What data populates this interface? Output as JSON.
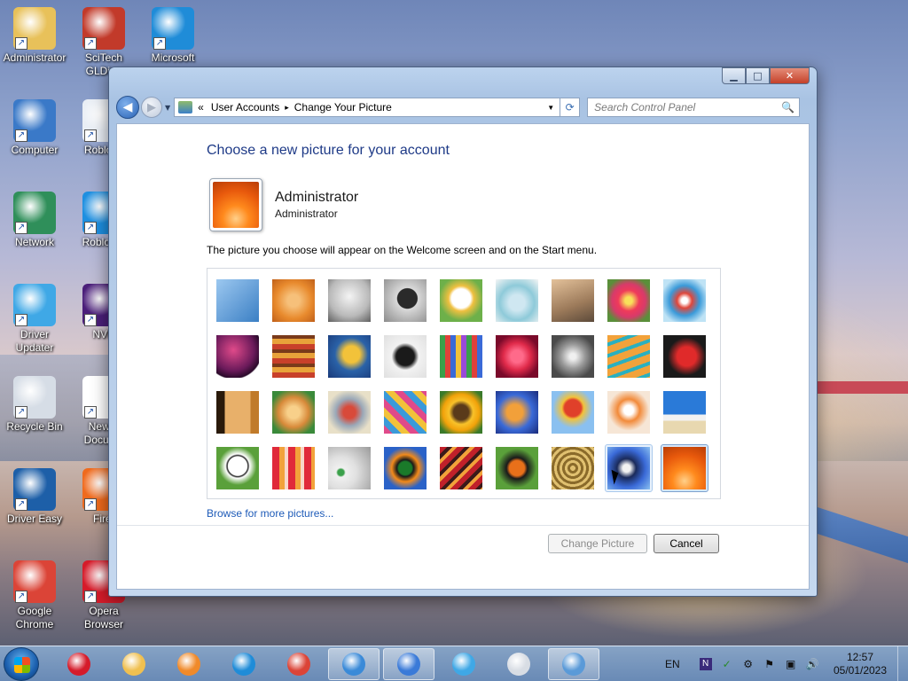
{
  "desktop": {
    "icons": [
      {
        "label": "Administrator",
        "icon": "user-folder-icon",
        "color": "#e8c15a"
      },
      {
        "label": "SciTech GLDir...",
        "icon": "scitech-app-icon",
        "color": "#c23a2a"
      },
      {
        "label": "Microsoft",
        "icon": "edge-icon",
        "color": "#1f8cd8"
      },
      {
        "label": "Computer",
        "icon": "computer-icon",
        "color": "#3a79c8"
      },
      {
        "label": "Roblox I",
        "icon": "roblox-icon",
        "color": "#e9eef5"
      },
      {
        "label": "Network",
        "icon": "network-icon",
        "color": "#2f8f5a"
      },
      {
        "label": "Roblox S",
        "icon": "roblox-studio-icon",
        "color": "#1e8fe0"
      },
      {
        "label": "Driver Updater",
        "icon": "driver-updater-icon",
        "color": "#3fa8e6"
      },
      {
        "label": "NVD",
        "icon": "nvda-icon",
        "color": "#4b1f7a"
      },
      {
        "label": "Recycle Bin",
        "icon": "recycle-bin-icon",
        "color": "#d6dde6"
      },
      {
        "label": "New T Docume",
        "icon": "text-document-icon",
        "color": "#ffffff"
      },
      {
        "label": "Driver Easy",
        "icon": "driver-easy-icon",
        "color": "#1d5fa8"
      },
      {
        "label": "Firef",
        "icon": "firefox-icon",
        "color": "#ef6a1d"
      },
      {
        "label": "Google Chrome",
        "icon": "chrome-icon",
        "color": "#db4437"
      },
      {
        "label": "Opera Browser",
        "icon": "opera-icon",
        "color": "#d51b2a"
      }
    ]
  },
  "window": {
    "controls": {
      "minimize": "▁",
      "maximize": "□",
      "close": "✕"
    },
    "nav": {
      "back": "◀",
      "forward": "▶",
      "history": "▼"
    },
    "address": {
      "prefix": "«",
      "crumbs": [
        "User Accounts",
        "Change Your Picture"
      ],
      "separator": "▸",
      "dropdown": "▼"
    },
    "refresh": "⟳",
    "search": {
      "placeholder": "Search Control Panel",
      "icon": "🔍"
    },
    "heading": "Choose a new picture for your account",
    "user": {
      "name": "Administrator",
      "type": "Administrator"
    },
    "info": "The picture you choose will appear on the Welcome screen and on the Start menu.",
    "pictures": [
      {
        "name": "roller-coaster",
        "bg": "linear-gradient(135deg,#9cc8f0,#3b7fc4)"
      },
      {
        "name": "starfish",
        "bg": "radial-gradient(circle,#f6c07a 20%,#e88a2d 60%,#c0601a)"
      },
      {
        "name": "robot-figure",
        "bg": "radial-gradient(circle at 50% 40%,#f4f4f4,#b9b9b9 60%,#5f5f5f)"
      },
      {
        "name": "record-player",
        "bg": "radial-gradient(circle at 55% 45%,#2a2a2a 30%,#d9d9d9 32%,#8b8b8b)"
      },
      {
        "name": "lucky-cat",
        "bg": "radial-gradient(circle at 50% 45%,#fff 30%,#f0c040 40%,#6db04a 70%)"
      },
      {
        "name": "spinning-top",
        "bg": "radial-gradient(circle at 50% 55%,#cfe7f1 25%,#8ecad9 55%,#f5f5f5)"
      },
      {
        "name": "cat",
        "bg": "linear-gradient(160deg,#e3c19a,#9c7a5a 60%,#5c4a3a)"
      },
      {
        "name": "flower",
        "bg": "radial-gradient(circle,#f8e05a 12%,#ef3a5a 35%,#d83a6a 55%,#5a8f3a 80%)"
      },
      {
        "name": "ferris-wheel",
        "bg": "radial-gradient(circle,#ffffff 10%,#e0463a 25%,#3a9ad9 50%,#bfe3f5 80%)"
      },
      {
        "name": "ball",
        "bg": "radial-gradient(circle at 40% 35%,#e04a8a,#6a1a5a 55%,#2a0a2a 75%,#ffffff 78%)"
      },
      {
        "name": "fabric",
        "bg": "repeating-linear-gradient(0deg,#c8402a 0 6px,#e8a23a 6px 12px,#7a3a1a 12px 16px)"
      },
      {
        "name": "leaf",
        "bg": "radial-gradient(circle at 55% 45%,#f2c23a 25%,#2a62a8 50%,#1a3a7a)"
      },
      {
        "name": "dog",
        "bg": "radial-gradient(circle at 50% 50%,#1a1a1a 30%,#f2f2f2 45%,#e0e0e0)"
      },
      {
        "name": "crayons",
        "bg": "repeating-linear-gradient(90deg,#3aa04a 0 6px,#e0403a 6px 12px,#3a6ad8 12px 18px,#f2c23a 18px 24px,#9a4ad8 24px 30px)"
      },
      {
        "name": "star-lantern",
        "bg": "radial-gradient(circle,#ff6a8a 20%,#e02a4a 45%,#7a0a2a 75%)"
      },
      {
        "name": "jacks",
        "bg": "radial-gradient(circle,#f0f0f0 10%,#9a9a9a 40%,#4a4a4a 75%)"
      },
      {
        "name": "stairs",
        "bg": "repeating-linear-gradient(160deg,#f2a23a 0 8px,#2ab0c0 8px 12px)"
      },
      {
        "name": "origami-crane",
        "bg": "radial-gradient(circle at 55% 50%,#e02a2a 30%,#1a1a1a 60%)"
      },
      {
        "name": "guitar",
        "bg": "linear-gradient(90deg,#2a1a0a 0 20%,#e8b06a 20% 80%,#c07a2a 80%)"
      },
      {
        "name": "pomeranian",
        "bg": "radial-gradient(circle,#f8d08a 20%,#d88a3a 50%,#3a8a3a 80%)"
      },
      {
        "name": "toy-robot",
        "bg": "radial-gradient(circle,#d84a3a 20%,#9aa8b8 45%,#e8e0c8 75%)"
      },
      {
        "name": "scarves",
        "bg": "repeating-linear-gradient(45deg,#e04a8a 0 7px,#3a9ad9 7px 14px,#f2c23a 14px 21px)"
      },
      {
        "name": "sunflower",
        "bg": "radial-gradient(circle,#5a3a1a 25%,#f8c22a 40%,#f2a20a 60%,#3a7a2a 85%)"
      },
      {
        "name": "fish",
        "bg": "radial-gradient(circle at 45% 50%,#f2a03a 25%,#3a6ad8 55%,#1a2a7a)"
      },
      {
        "name": "hot-air-balloon",
        "bg": "radial-gradient(circle at 50% 40%,#e0402a 25%,#f2c23a 33%,#8ac0f0 60%)"
      },
      {
        "name": "doll",
        "bg": "radial-gradient(circle at 50% 45%,#ffffff 15%,#f28a3a 35%,#f6e6d6 65%)"
      },
      {
        "name": "beach",
        "bg": "linear-gradient(180deg,#2a7ad8 0 55%,#f2f2f2 55% 70%,#e8d8b0 70%)"
      },
      {
        "name": "soccer-ball",
        "bg": "radial-gradient(circle at 50% 45%,#ffffff 30%,#1a1a1a 33%,#ffffff 38%,#5aa03a 60%)"
      },
      {
        "name": "silk",
        "bg": "repeating-linear-gradient(90deg,#e02a3a 0 8px,#f2a23a 8px 14px,#f8d8c8 14px 18px)"
      },
      {
        "name": "marbles",
        "bg": "radial-gradient(circle at 30% 60%,#3aa04a 8%,#f0f0f0 12%,#e0e0e0 40%,#9a9a9a)"
      },
      {
        "name": "window-frame",
        "bg": "radial-gradient(circle,#1a7a2a 22%,#1a1a1a 28%,#f28a1a 45%,#2a62c8 70%)"
      },
      {
        "name": "rug",
        "bg": "repeating-linear-gradient(135deg,#c0202a 0 6px,#3a1a1a 6px 10px,#f2a23a 10px 14px)"
      },
      {
        "name": "butterfly",
        "bg": "radial-gradient(circle,#e8701a 25%,#1a1a1a 35%,#5aa03a 65%)"
      },
      {
        "name": "basket",
        "bg": "repeating-radial-gradient(circle,#e0c070 0 3px,#8a6a2a 3px 6px)"
      },
      {
        "name": "lighthouse",
        "bg": "radial-gradient(circle at 45% 50%,#f2f2f2 12%,#1a2a5a 30%,#3a6ad8 60%,#8ac0f0)"
      },
      {
        "name": "orange-flower",
        "bg": "radial-gradient(circle at 50% 80%,#ffd08a 0%,#ff8a1d 30%,#e8590c 65%,#b83d06 100%)"
      }
    ],
    "browse_link": "Browse for more pictures...",
    "buttons": {
      "change": "Change Picture",
      "cancel": "Cancel"
    }
  },
  "taskbar": {
    "apps": [
      {
        "name": "opera",
        "color": "#d51b2a"
      },
      {
        "name": "file-explorer",
        "color": "#f0c050"
      },
      {
        "name": "media-player",
        "color": "#f08a2a"
      },
      {
        "name": "edge",
        "color": "#1f8cd8"
      },
      {
        "name": "chrome",
        "color": "#db4437"
      },
      {
        "name": "network-app",
        "color": "#3a8ad8"
      },
      {
        "name": "bird-app",
        "color": "#3a7ad8"
      },
      {
        "name": "driver-updater",
        "color": "#3fa8e6"
      },
      {
        "name": "roblox",
        "color": "#d8dde4"
      },
      {
        "name": "control-panel",
        "color": "#5a9ad8"
      }
    ],
    "tray": {
      "lang": "EN",
      "icons": [
        "N",
        "✓",
        "⚙",
        "⚑",
        "▣",
        "🔊"
      ]
    },
    "clock": {
      "time": "12:57",
      "date": "05/01/2023"
    }
  }
}
